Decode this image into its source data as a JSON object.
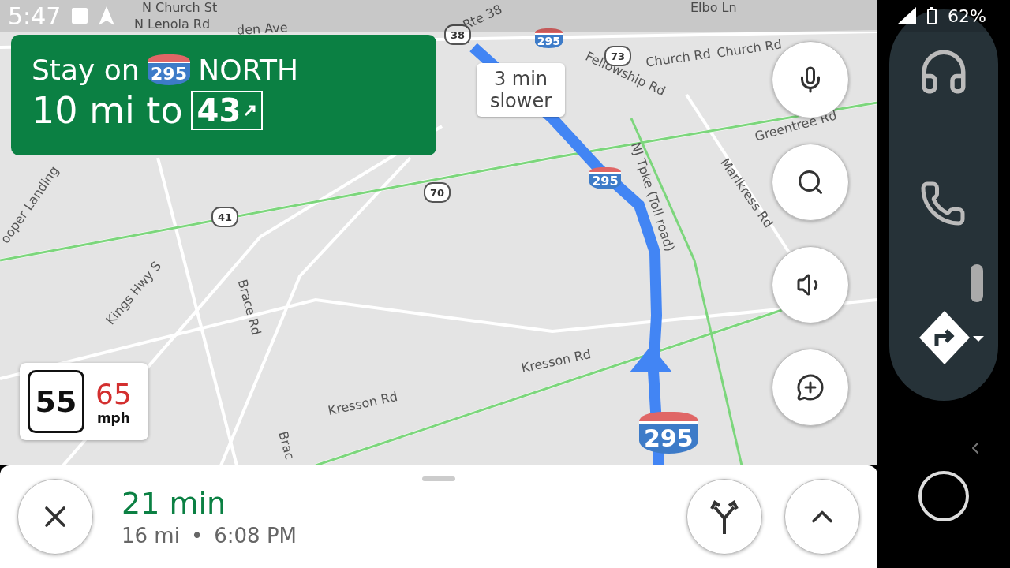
{
  "status_bar": {
    "time": "5:47",
    "battery": "62%"
  },
  "instruction": {
    "line1_prefix": "Stay on",
    "shield": "295",
    "direction": "NORTH",
    "line2_prefix": "10 mi to",
    "exit": "43"
  },
  "traffic_callout": {
    "text": "3 min slower"
  },
  "map_labels": [
    "N Church St",
    "N Lenola Rd",
    "den Ave",
    "Rte 38",
    "Elbo Ln",
    "Fellowship Rd",
    "Church Rd",
    "Church Rd",
    "NJ Tpke (Toll road)",
    "Greentree Rd",
    "Marlkress Rd",
    "ooper Landing",
    "Kings Hwy S",
    "Brace Rd",
    "Kresson Rd",
    "Kresson Rd",
    "Brac"
  ],
  "route_markers": [
    "70",
    "41",
    "38",
    "73"
  ],
  "route_shields": [
    "295",
    "295",
    "295"
  ],
  "speed": {
    "limit": "55",
    "current": "65",
    "unit": "mph"
  },
  "trip": {
    "duration": "21 min",
    "distance": "16 mi",
    "separator": "•",
    "eta": "6:08 PM"
  }
}
